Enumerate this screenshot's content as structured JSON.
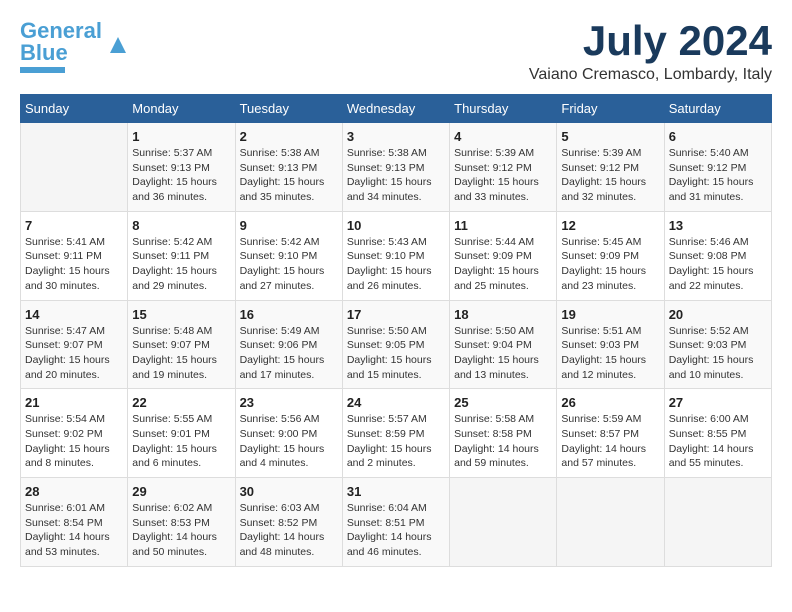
{
  "header": {
    "logo_line1": "General",
    "logo_line2": "Blue",
    "month_year": "July 2024",
    "location": "Vaiano Cremasco, Lombardy, Italy"
  },
  "calendar": {
    "days_of_week": [
      "Sunday",
      "Monday",
      "Tuesday",
      "Wednesday",
      "Thursday",
      "Friday",
      "Saturday"
    ],
    "weeks": [
      [
        {
          "day": "",
          "info": ""
        },
        {
          "day": "1",
          "info": "Sunrise: 5:37 AM\nSunset: 9:13 PM\nDaylight: 15 hours\nand 36 minutes."
        },
        {
          "day": "2",
          "info": "Sunrise: 5:38 AM\nSunset: 9:13 PM\nDaylight: 15 hours\nand 35 minutes."
        },
        {
          "day": "3",
          "info": "Sunrise: 5:38 AM\nSunset: 9:13 PM\nDaylight: 15 hours\nand 34 minutes."
        },
        {
          "day": "4",
          "info": "Sunrise: 5:39 AM\nSunset: 9:12 PM\nDaylight: 15 hours\nand 33 minutes."
        },
        {
          "day": "5",
          "info": "Sunrise: 5:39 AM\nSunset: 9:12 PM\nDaylight: 15 hours\nand 32 minutes."
        },
        {
          "day": "6",
          "info": "Sunrise: 5:40 AM\nSunset: 9:12 PM\nDaylight: 15 hours\nand 31 minutes."
        }
      ],
      [
        {
          "day": "7",
          "info": "Sunrise: 5:41 AM\nSunset: 9:11 PM\nDaylight: 15 hours\nand 30 minutes."
        },
        {
          "day": "8",
          "info": "Sunrise: 5:42 AM\nSunset: 9:11 PM\nDaylight: 15 hours\nand 29 minutes."
        },
        {
          "day": "9",
          "info": "Sunrise: 5:42 AM\nSunset: 9:10 PM\nDaylight: 15 hours\nand 27 minutes."
        },
        {
          "day": "10",
          "info": "Sunrise: 5:43 AM\nSunset: 9:10 PM\nDaylight: 15 hours\nand 26 minutes."
        },
        {
          "day": "11",
          "info": "Sunrise: 5:44 AM\nSunset: 9:09 PM\nDaylight: 15 hours\nand 25 minutes."
        },
        {
          "day": "12",
          "info": "Sunrise: 5:45 AM\nSunset: 9:09 PM\nDaylight: 15 hours\nand 23 minutes."
        },
        {
          "day": "13",
          "info": "Sunrise: 5:46 AM\nSunset: 9:08 PM\nDaylight: 15 hours\nand 22 minutes."
        }
      ],
      [
        {
          "day": "14",
          "info": "Sunrise: 5:47 AM\nSunset: 9:07 PM\nDaylight: 15 hours\nand 20 minutes."
        },
        {
          "day": "15",
          "info": "Sunrise: 5:48 AM\nSunset: 9:07 PM\nDaylight: 15 hours\nand 19 minutes."
        },
        {
          "day": "16",
          "info": "Sunrise: 5:49 AM\nSunset: 9:06 PM\nDaylight: 15 hours\nand 17 minutes."
        },
        {
          "day": "17",
          "info": "Sunrise: 5:50 AM\nSunset: 9:05 PM\nDaylight: 15 hours\nand 15 minutes."
        },
        {
          "day": "18",
          "info": "Sunrise: 5:50 AM\nSunset: 9:04 PM\nDaylight: 15 hours\nand 13 minutes."
        },
        {
          "day": "19",
          "info": "Sunrise: 5:51 AM\nSunset: 9:03 PM\nDaylight: 15 hours\nand 12 minutes."
        },
        {
          "day": "20",
          "info": "Sunrise: 5:52 AM\nSunset: 9:03 PM\nDaylight: 15 hours\nand 10 minutes."
        }
      ],
      [
        {
          "day": "21",
          "info": "Sunrise: 5:54 AM\nSunset: 9:02 PM\nDaylight: 15 hours\nand 8 minutes."
        },
        {
          "day": "22",
          "info": "Sunrise: 5:55 AM\nSunset: 9:01 PM\nDaylight: 15 hours\nand 6 minutes."
        },
        {
          "day": "23",
          "info": "Sunrise: 5:56 AM\nSunset: 9:00 PM\nDaylight: 15 hours\nand 4 minutes."
        },
        {
          "day": "24",
          "info": "Sunrise: 5:57 AM\nSunset: 8:59 PM\nDaylight: 15 hours\nand 2 minutes."
        },
        {
          "day": "25",
          "info": "Sunrise: 5:58 AM\nSunset: 8:58 PM\nDaylight: 14 hours\nand 59 minutes."
        },
        {
          "day": "26",
          "info": "Sunrise: 5:59 AM\nSunset: 8:57 PM\nDaylight: 14 hours\nand 57 minutes."
        },
        {
          "day": "27",
          "info": "Sunrise: 6:00 AM\nSunset: 8:55 PM\nDaylight: 14 hours\nand 55 minutes."
        }
      ],
      [
        {
          "day": "28",
          "info": "Sunrise: 6:01 AM\nSunset: 8:54 PM\nDaylight: 14 hours\nand 53 minutes."
        },
        {
          "day": "29",
          "info": "Sunrise: 6:02 AM\nSunset: 8:53 PM\nDaylight: 14 hours\nand 50 minutes."
        },
        {
          "day": "30",
          "info": "Sunrise: 6:03 AM\nSunset: 8:52 PM\nDaylight: 14 hours\nand 48 minutes."
        },
        {
          "day": "31",
          "info": "Sunrise: 6:04 AM\nSunset: 8:51 PM\nDaylight: 14 hours\nand 46 minutes."
        },
        {
          "day": "",
          "info": ""
        },
        {
          "day": "",
          "info": ""
        },
        {
          "day": "",
          "info": ""
        }
      ]
    ]
  }
}
